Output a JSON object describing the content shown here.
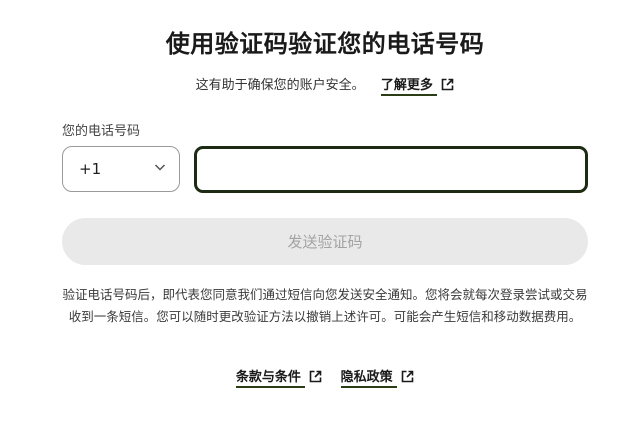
{
  "title": "使用验证码验证您的电话号码",
  "subtitle": {
    "text": "这有助于确保您的账户安全。",
    "learn_more": "了解更多"
  },
  "phone": {
    "label": "您的电话号码",
    "country_code": "+1",
    "value": "",
    "placeholder": ""
  },
  "send_button": "发送验证码",
  "disclaimer": "验证电话号码后，即代表您同意我们通过短信向您发送安全通知。您将会就每次登录尝试或交易收到一条短信。您可以随时更改验证方法以撤销上述许可。可能会产生短信和移动数据费用。",
  "links": {
    "terms": "条款与条件",
    "privacy": "隐私政策"
  },
  "colors": {
    "accent": "#1d2b12",
    "button_bg": "#e9e9e9",
    "button_text": "#a3a3a3"
  }
}
